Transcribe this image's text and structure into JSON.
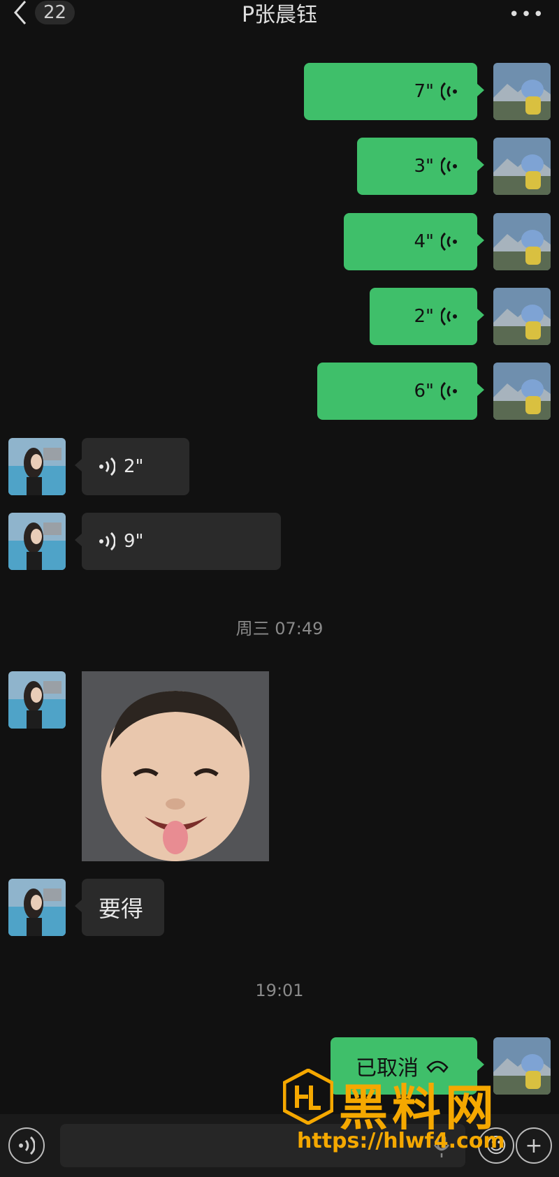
{
  "header": {
    "back_count": "22",
    "title": "P张晨钰"
  },
  "outgoing_voice": [
    {
      "duration": "7\""
    },
    {
      "duration": "3\""
    },
    {
      "duration": "4\""
    },
    {
      "duration": "2\""
    },
    {
      "duration": "6\""
    }
  ],
  "incoming_voice": [
    {
      "duration": "2\""
    },
    {
      "duration": "9\""
    }
  ],
  "timestamps": {
    "t1": "周三 07:49",
    "t2": "19:01"
  },
  "incoming_text": {
    "text": "要得"
  },
  "call_message": {
    "text": "已取消"
  },
  "watermark": {
    "brand": "黑料网",
    "url": "https://hlwf4.com"
  },
  "colors": {
    "out_bubble": "#3fbf6a",
    "in_bubble": "#2a2a2a",
    "background": "#111111",
    "watermark": "#f5a800"
  }
}
